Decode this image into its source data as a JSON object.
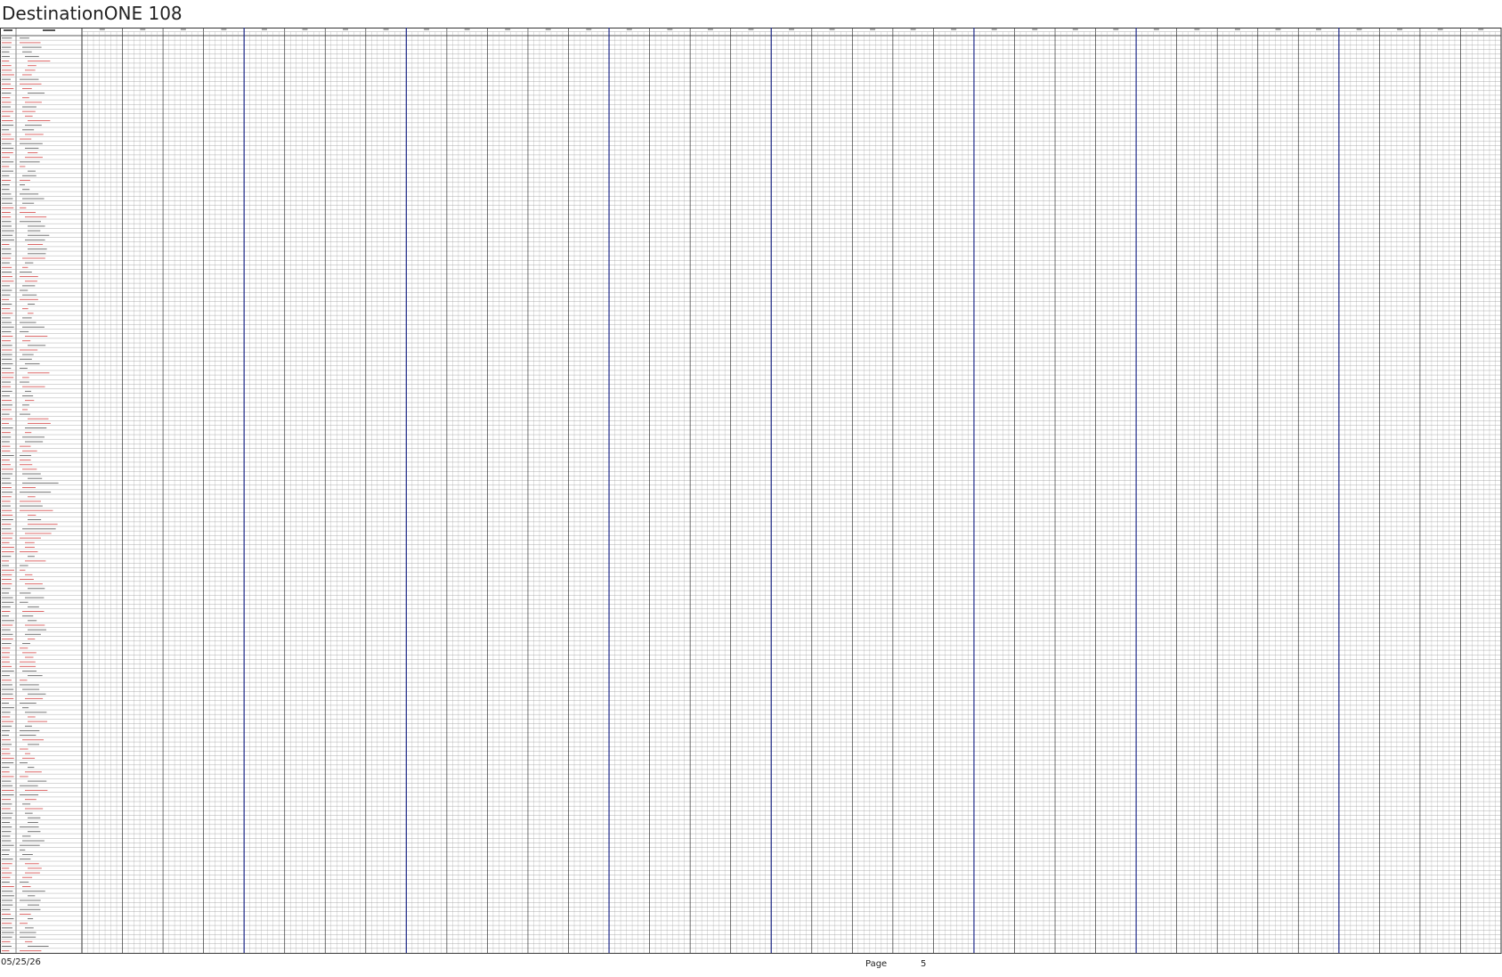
{
  "document": {
    "title": "DestinationONE 108"
  },
  "table": {
    "headers": [
      "",
      ""
    ],
    "row_count": 200,
    "week_column_count": 35,
    "subcolumns_per_week": 7
  },
  "colors": {
    "grid": "#9a9a9a",
    "grid_dark": "#333333",
    "week_separator": "#1f2a8a",
    "red_text": "#cc2222",
    "black_text": "#333333"
  },
  "footer": {
    "date": "05/25/26",
    "page_label": "Page",
    "page_number": "5"
  }
}
